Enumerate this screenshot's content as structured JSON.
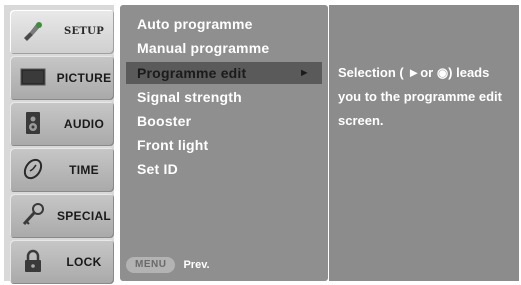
{
  "sidebar": {
    "items": [
      {
        "label": "SETUP",
        "icon": "setup-icon",
        "active": true
      },
      {
        "label": "PICTURE",
        "icon": "picture-icon",
        "active": false
      },
      {
        "label": "AUDIO",
        "icon": "audio-icon",
        "active": false
      },
      {
        "label": "TIME",
        "icon": "time-icon",
        "active": false
      },
      {
        "label": "SPECIAL",
        "icon": "special-icon",
        "active": false
      },
      {
        "label": "LOCK",
        "icon": "lock-icon",
        "active": false
      }
    ]
  },
  "menu": {
    "items": [
      {
        "label": "Auto programme"
      },
      {
        "label": "Manual programme"
      },
      {
        "label": "Programme edit",
        "selected": true,
        "arrow": "►"
      },
      {
        "label": "Signal strength"
      },
      {
        "label": "Booster"
      },
      {
        "label": "Front light"
      },
      {
        "label": "Set ID"
      }
    ],
    "footer": {
      "key_label": "MENU",
      "prev_label": "Prev."
    }
  },
  "info": {
    "text": "Selection ( ►or ◉) leads you to the programme edit screen."
  },
  "colors": {
    "sidebar_bg": "#d9d9d9",
    "menu_bg": "#8f8f8f",
    "selection_bg": "#5a5a5a",
    "info_bg": "#8c8c8c"
  }
}
